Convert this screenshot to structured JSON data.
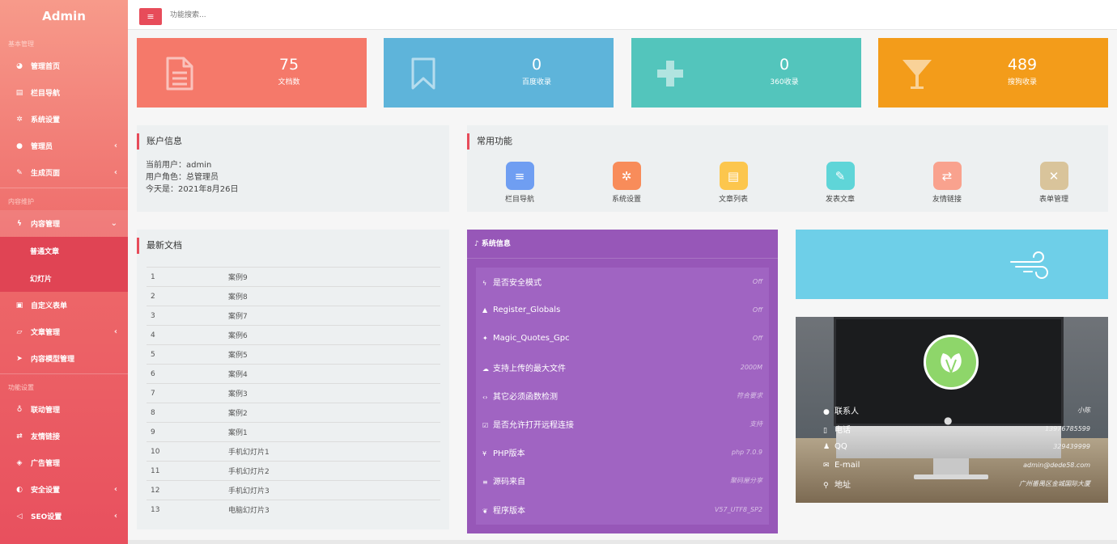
{
  "sidebar": {
    "brand": "Admin",
    "groups": [
      {
        "title": "基本管理",
        "items": [
          {
            "label": "管理首页",
            "icon": "dashboard-icon"
          },
          {
            "label": "栏目导航",
            "icon": "list-icon"
          },
          {
            "label": "系统设置",
            "icon": "gear-icon"
          },
          {
            "label": "管理员",
            "icon": "user-icon"
          },
          {
            "label": "生成页面",
            "icon": "brush-icon"
          }
        ]
      },
      {
        "title": "内容维护",
        "items": [
          {
            "label": "内容管理",
            "icon": "bolt-icon"
          },
          {
            "label": "普通文章"
          },
          {
            "label": "幻灯片"
          },
          {
            "label": "自定义表单",
            "icon": "form-icon"
          },
          {
            "label": "文章管理",
            "icon": "folder-icon"
          },
          {
            "label": "内容模型管理",
            "icon": "send-icon"
          }
        ]
      },
      {
        "title": "功能设置",
        "items": [
          {
            "label": "联动管理",
            "icon": "pin-icon"
          },
          {
            "label": "友情链接",
            "icon": "retweet-icon"
          },
          {
            "label": "广告管理",
            "icon": "cube-icon"
          },
          {
            "label": "安全设置",
            "icon": "shield-icon"
          },
          {
            "label": "SEO设置",
            "icon": "share-icon"
          }
        ]
      }
    ]
  },
  "topbar": {
    "search_placeholder": "功能搜索...",
    "menu_icon": "hamburger-icon"
  },
  "stats": [
    {
      "value": "75",
      "label": "文档数",
      "icon": "document-icon",
      "color": "#f5796a"
    },
    {
      "value": "0",
      "label": "百度收录",
      "icon": "bookmark-icon",
      "color": "#5eb4da"
    },
    {
      "value": "0",
      "label": "360收录",
      "icon": "plus-icon",
      "color": "#53c5bc"
    },
    {
      "value": "489",
      "label": "搜狗收录",
      "icon": "filter-icon",
      "color": "#f39c1a"
    }
  ],
  "account": {
    "title": "账户信息",
    "lines": [
      "当前用户：admin",
      "用户角色：总管理员",
      "今天是：2021年8月26日"
    ]
  },
  "common": {
    "title": "常用功能",
    "items": [
      {
        "label": "栏目导航",
        "icon": "list-icon",
        "color": "#6f9ef2"
      },
      {
        "label": "系统设置",
        "icon": "gear-icon",
        "color": "#f88c5a"
      },
      {
        "label": "文章列表",
        "icon": "file-icon",
        "color": "#fcc64d"
      },
      {
        "label": "发表文章",
        "icon": "brush-icon",
        "color": "#5fd5d8"
      },
      {
        "label": "友情链接",
        "icon": "retweet-icon",
        "color": "#f9a28e"
      },
      {
        "label": "表单管理",
        "icon": "excel-icon",
        "color": "#d9c49b"
      }
    ]
  },
  "docs": {
    "title": "最新文档",
    "rows": [
      [
        "1",
        "案例9"
      ],
      [
        "2",
        "案例8"
      ],
      [
        "3",
        "案例7"
      ],
      [
        "4",
        "案例6"
      ],
      [
        "5",
        "案例5"
      ],
      [
        "6",
        "案例4"
      ],
      [
        "7",
        "案例3"
      ],
      [
        "8",
        "案例2"
      ],
      [
        "9",
        "案例1"
      ],
      [
        "10",
        "手机幻灯片1"
      ],
      [
        "11",
        "手机幻灯片2"
      ],
      [
        "12",
        "手机幻灯片3"
      ],
      [
        "13",
        "电脑幻灯片3"
      ]
    ]
  },
  "sysinfo": {
    "title": "系统信息",
    "rows": [
      {
        "key": "是否安全模式",
        "value": "Off",
        "icon": "bolt-icon"
      },
      {
        "key": "Register_Globals",
        "value": "Off",
        "icon": "flask-icon"
      },
      {
        "key": "Magic_Quotes_Gpc",
        "value": "Off",
        "icon": "magic-icon"
      },
      {
        "key": "支持上传的最大文件",
        "value": "2000M",
        "icon": "cloud-upload-icon"
      },
      {
        "key": "其它必须函数检测",
        "value": "符合要求",
        "icon": "code-icon"
      },
      {
        "key": "是否允许打开远程连接",
        "value": "支持",
        "icon": "checkbox-icon"
      },
      {
        "key": "PHP版本",
        "value": "php 7.0.9",
        "icon": "yen-icon"
      },
      {
        "key": "源码来自",
        "value": "聚码屋分享",
        "icon": "database-icon"
      },
      {
        "key": "程序版本",
        "value": "V57_UTF8_SP2",
        "icon": "leaf-icon"
      }
    ]
  },
  "contact": {
    "rows": [
      {
        "key": "联系人",
        "value": "小陈",
        "icon": "user-icon"
      },
      {
        "key": "电话",
        "value": "13976785599",
        "icon": "mobile-icon"
      },
      {
        "key": "QQ",
        "value": "329439999",
        "icon": "qq-icon"
      },
      {
        "key": "E-mail",
        "value": "admin@dede58.com",
        "icon": "envelope-icon"
      },
      {
        "key": "地址",
        "value": "广州番禺区金城国际大厦",
        "icon": "map-marker-icon"
      }
    ]
  }
}
